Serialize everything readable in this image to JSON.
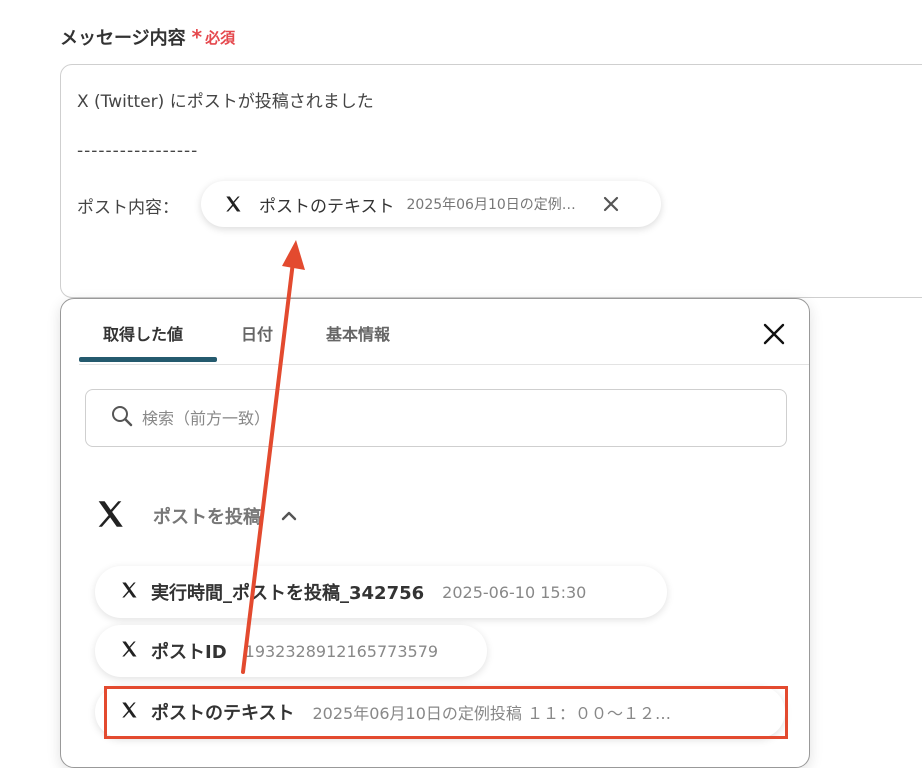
{
  "field": {
    "label": "メッセージ内容",
    "required_mark": "*",
    "required_text": "必須"
  },
  "message": {
    "line1": "X (Twitter) にポストが投稿されました",
    "line2": "-----------------",
    "line3_label": "ポスト内容："
  },
  "token": {
    "icon": "x-logo-icon",
    "name": "ポストのテキスト",
    "value": "2025年06月10日の定例投稿 １１：００〜１２…"
  },
  "popover": {
    "tabs": [
      {
        "label": "取得した値",
        "active": true
      },
      {
        "label": "日付",
        "active": false
      },
      {
        "label": "基本情報",
        "active": false
      }
    ],
    "search_placeholder": "検索（前方一致）",
    "section_title": "ポストを投稿",
    "items": [
      {
        "name": "実行時間_ポストを投稿_342756",
        "value": "2025-06-10 15:30"
      },
      {
        "name": "ポストID",
        "value": "1932328912165773579"
      },
      {
        "name": "ポストのテキスト",
        "value": "2025年06月10日の定例投稿 １１：００〜１２…",
        "highlighted": true
      }
    ]
  },
  "colors": {
    "required": "#e5484d",
    "tab_underline": "#245a6e",
    "annotation": "#e34a2f"
  }
}
